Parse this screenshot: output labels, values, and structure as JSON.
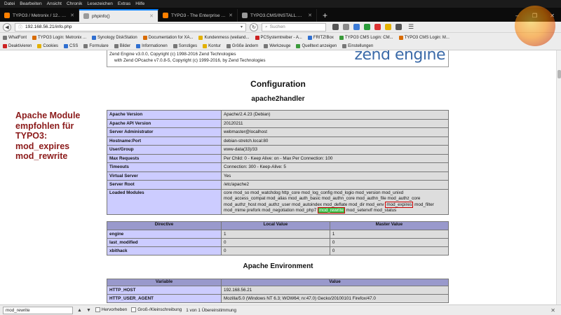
{
  "menubar": [
    "Datei",
    "Bearbeiten",
    "Ansicht",
    "Chronik",
    "Lesezeichen",
    "Extras",
    "Hilfe"
  ],
  "tabs": [
    {
      "label": "TYPO3 / Metronix / 12.. - 1...",
      "active": false
    },
    {
      "label": "phpinfo()",
      "active": true
    },
    {
      "label": "TYPO3 - The Enterprise O...",
      "active": false
    },
    {
      "label": "TYPO3.CMS/INSTALL.md a...",
      "active": false
    }
  ],
  "new_tab": "+",
  "window_buttons": [
    "–",
    "❐",
    "✕"
  ],
  "url": "192.168.56.21/info.php",
  "search_placeholder": "Suchen",
  "bookmarks1": [
    "WhatFont",
    "TYPO3 Login: Metronix ...",
    "Synology DiskStation",
    "Documentation for XA...",
    "Kundenmess (weiland...",
    "PCSystemtreiber - A...",
    "FRITZ!Box",
    "TYPO3 CMS Login: CM...",
    "TYPO3 CMS Login: M..."
  ],
  "bookmarks2": [
    "Deaktivieren",
    "Cookies",
    "CSS",
    "Formulare",
    "Bilder",
    "Informationen",
    "Sonstiges",
    "Kontur",
    "Größe ändern",
    "Werkzeuge",
    "Quelltext anzeigen",
    "Einstellungen"
  ],
  "zend": {
    "line1": "Zend Engine v3.0.0, Copyright (c) 1998-2016 Zend Technologies",
    "line2": "with Zend OPcache v7.0.8-5, Copyright (c) 1999-2016, by Zend Technologies",
    "logo": "zend engine"
  },
  "headings": {
    "configuration": "Configuration",
    "apache2handler": "apache2handler",
    "apache_env": "Apache Environment"
  },
  "apache_rows": [
    {
      "k": "Apache Version",
      "v": "Apache/2.4.23 (Debian)"
    },
    {
      "k": "Apache API Version",
      "v": "20120211"
    },
    {
      "k": "Server Administrator",
      "v": "webmaster@localhost"
    },
    {
      "k": "Hostname:Port",
      "v": "debian-stretch.local:80"
    },
    {
      "k": "User/Group",
      "v": "www-data(33)/33"
    },
    {
      "k": "Max Requests",
      "v": "Per Child: 0 - Keep Alive: on - Max Per Connection: 100"
    },
    {
      "k": "Timeouts",
      "v": "Connection: 300 - Keep-Alive: 5"
    },
    {
      "k": "Virtual Server",
      "v": "Yes"
    },
    {
      "k": "Server Root",
      "v": "/etc/apache2"
    }
  ],
  "loaded_modules": {
    "label": "Loaded Modules",
    "part1": "core mod_so mod_watchdog http_core mod_log_config mod_logio mod_version mod_unixd mod_access_compat mod_alias mod_auth_basic mod_authn_core mod_authn_file mod_authz_core mod_authz_host mod_authz_user mod_autoindex mod_deflate mod_dir mod_env ",
    "expires": "mod_expires",
    "part2": " mod_filter mod_mime prefork mod_negotiation mod_php7 ",
    "rewrite": "mod_rewrite",
    "part3": " mod_setenvif mod_status"
  },
  "directive_table": {
    "headers": [
      "Directive",
      "Local Value",
      "Master Value"
    ],
    "rows": [
      [
        "engine",
        "1",
        "1"
      ],
      [
        "last_modified",
        "0",
        "0"
      ],
      [
        "xbithack",
        "0",
        "0"
      ]
    ]
  },
  "env_table": {
    "headers": [
      "Variable",
      "Value"
    ],
    "rows": [
      [
        "HTTP_HOST",
        "192.168.56.21"
      ],
      [
        "HTTP_USER_AGENT",
        "Mozilla/5.0 (Windows NT 6.3; WOW64; rv:47.0) Gecko/20100101 Firefox/47.0"
      ]
    ]
  },
  "annotation": "Apache Module\nempfohlen für\nTYPO3:\nmod_expires\nmod_rewrite",
  "findbar": {
    "value": "mod_rewrite",
    "prev_label": "Hervorheben",
    "case_label": "Groß-/Kleinschreibung",
    "result": "1 von 1 Übereinstimmung",
    "close": "✕"
  },
  "colors": {
    "table_key_bg": "#ccccff",
    "table_val_bg": "#dddddd",
    "table_head_bg": "#9999cc",
    "annotation": "#8b1a1a",
    "highlight_green": "#3bbf4a"
  }
}
